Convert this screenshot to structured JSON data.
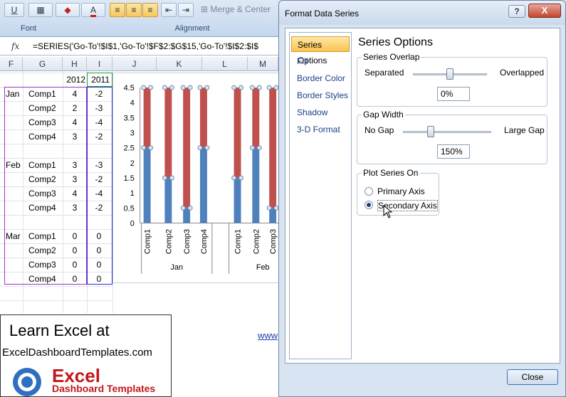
{
  "ribbon": {
    "font_group_label": "Font",
    "alignment_group_label": "Alignment",
    "underline_label": "U",
    "font_color_label": "A",
    "merge_center_label": "Merge & Center"
  },
  "formula_bar": {
    "fx_label": "fx",
    "formula": "=SERIES('Go-To'!$I$1,'Go-To'!$F$2:$G$15,'Go-To'!$I$2:$I$"
  },
  "sheet": {
    "columns": [
      "F",
      "G",
      "H",
      "I",
      "J",
      "K",
      "L",
      "M"
    ],
    "header_h": "2012",
    "header_i": "2011",
    "rows": [
      {
        "month": "Jan",
        "comp": "Comp1",
        "h": "4",
        "i": "-2"
      },
      {
        "month": "",
        "comp": "Comp2",
        "h": "2",
        "i": "-3"
      },
      {
        "month": "",
        "comp": "Comp3",
        "h": "4",
        "i": "-4"
      },
      {
        "month": "",
        "comp": "Comp4",
        "h": "3",
        "i": "-2"
      },
      {
        "month": "",
        "comp": "",
        "h": "",
        "i": ""
      },
      {
        "month": "Feb",
        "comp": "Comp1",
        "h": "3",
        "i": "-3"
      },
      {
        "month": "",
        "comp": "Comp2",
        "h": "3",
        "i": "-2"
      },
      {
        "month": "",
        "comp": "Comp3",
        "h": "4",
        "i": "-4"
      },
      {
        "month": "",
        "comp": "Comp4",
        "h": "3",
        "i": "-2"
      },
      {
        "month": "",
        "comp": "",
        "h": "",
        "i": ""
      },
      {
        "month": "Mar",
        "comp": "Comp1",
        "h": "0",
        "i": "0"
      },
      {
        "month": "",
        "comp": "Comp2",
        "h": "0",
        "i": "0"
      },
      {
        "month": "",
        "comp": "Comp3",
        "h": "0",
        "i": "0"
      },
      {
        "month": "",
        "comp": "Comp4",
        "h": "0",
        "i": "0"
      }
    ]
  },
  "chart_data": {
    "type": "bar",
    "ylim": [
      0,
      4.5
    ],
    "yticks": [
      "0",
      "0.5",
      "1",
      "1.5",
      "2",
      "2.5",
      "3",
      "3.5",
      "4",
      "4.5"
    ],
    "categories": [
      "Comp1",
      "Comp2",
      "Comp3",
      "Comp4",
      "Comp1",
      "Comp2",
      "Comp3"
    ],
    "groups": [
      "Jan",
      "Feb"
    ],
    "series": [
      {
        "color": "#4f81bd",
        "values": [
          2.5,
          1.5,
          0.5,
          2.5,
          1.5,
          2.5,
          0.5
        ]
      },
      {
        "color": "#c0504d",
        "values": [
          4.5,
          4.5,
          4.5,
          4.5,
          4.5,
          4.5,
          4.5
        ]
      }
    ]
  },
  "learn_box": {
    "title": "Learn Excel at",
    "url": "ExcelDashboardTemplates.com",
    "logo_main": "Excel",
    "logo_sub": "Dashboard Templates"
  },
  "www_text": "www",
  "dialog": {
    "title": "Format Data Series",
    "help_label": "?",
    "close_x_label": "X",
    "nav": [
      "Series Options",
      "Fill",
      "Border Color",
      "Border Styles",
      "Shadow",
      "3-D Format"
    ],
    "panel_title": "Series Options",
    "overlap": {
      "label": "Series Overlap",
      "left": "Separated",
      "right": "Overlapped",
      "value": "0%",
      "level": 0.5
    },
    "gap": {
      "label": "Gap Width",
      "left": "No Gap",
      "right": "Large Gap",
      "value": "150%",
      "level": 0.3
    },
    "plot_on": {
      "label": "Plot Series On",
      "primary": "Primary Axis",
      "secondary": "Secondary Axis",
      "selected": "secondary"
    },
    "close_label": "Close"
  },
  "colors": {
    "accent": "#f9c24d",
    "series_blue": "#4f81bd",
    "series_red": "#c0504d"
  }
}
